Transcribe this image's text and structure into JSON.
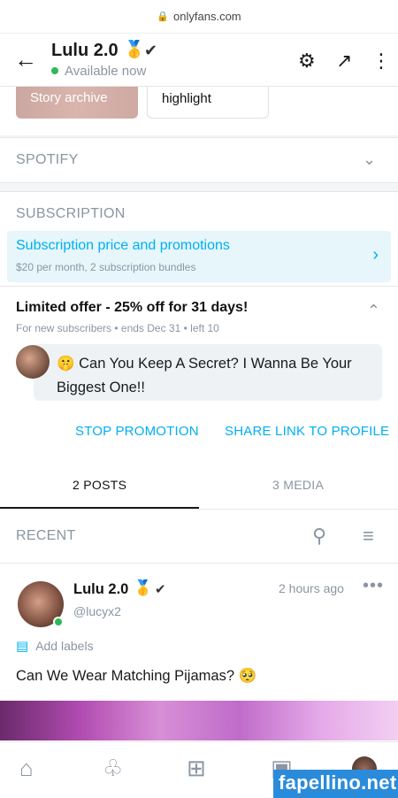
{
  "browser": {
    "url": "onlyfans.com"
  },
  "header": {
    "name": "Lulu 2.0",
    "status": "Available now"
  },
  "highlights": [
    {
      "label": "Story archive"
    },
    {
      "label": "highlight"
    }
  ],
  "spotify": {
    "title": "SPOTIFY"
  },
  "subscription": {
    "title": "SUBSCRIPTION",
    "promo_title": "Subscription price and promotions",
    "promo_sub": "$20 per month, 2 subscription bundles",
    "offer_title": "Limited offer - 25% off for 31 days!",
    "offer_meta": "For new subscribers  •  ends Dec 31  •  left 10",
    "message": "🤫 Can You Keep A Secret? I Wanna Be Your Biggest One!!",
    "stop_label": "STOP PROMOTION",
    "share_label": "SHARE LINK TO PROFILE"
  },
  "tabs": [
    {
      "label": "2 POSTS",
      "active": true
    },
    {
      "label": "3 MEDIA",
      "active": false
    }
  ],
  "recent": {
    "label": "RECENT"
  },
  "post": {
    "name": "Lulu 2.0",
    "handle": "@lucyx2",
    "time": "2 hours ago",
    "labels_text": "Add labels",
    "text": "Can We Wear Matching Pijamas? 🥺"
  },
  "watermark": "fapellino.net",
  "colors": {
    "accent": "#00aff0",
    "online": "#2dba55",
    "muted": "#8a96a3"
  },
  "icons": [
    "lock-icon",
    "back-arrow-icon",
    "medal-icon",
    "verified-icon",
    "gear-icon",
    "share-icon",
    "more-vertical-icon",
    "chevron-down-icon",
    "chevron-right-icon",
    "chevron-up-icon",
    "search-icon",
    "sort-icon",
    "more-horizontal-icon",
    "label-icon",
    "home-icon",
    "bell-icon",
    "add-icon",
    "messages-icon"
  ]
}
